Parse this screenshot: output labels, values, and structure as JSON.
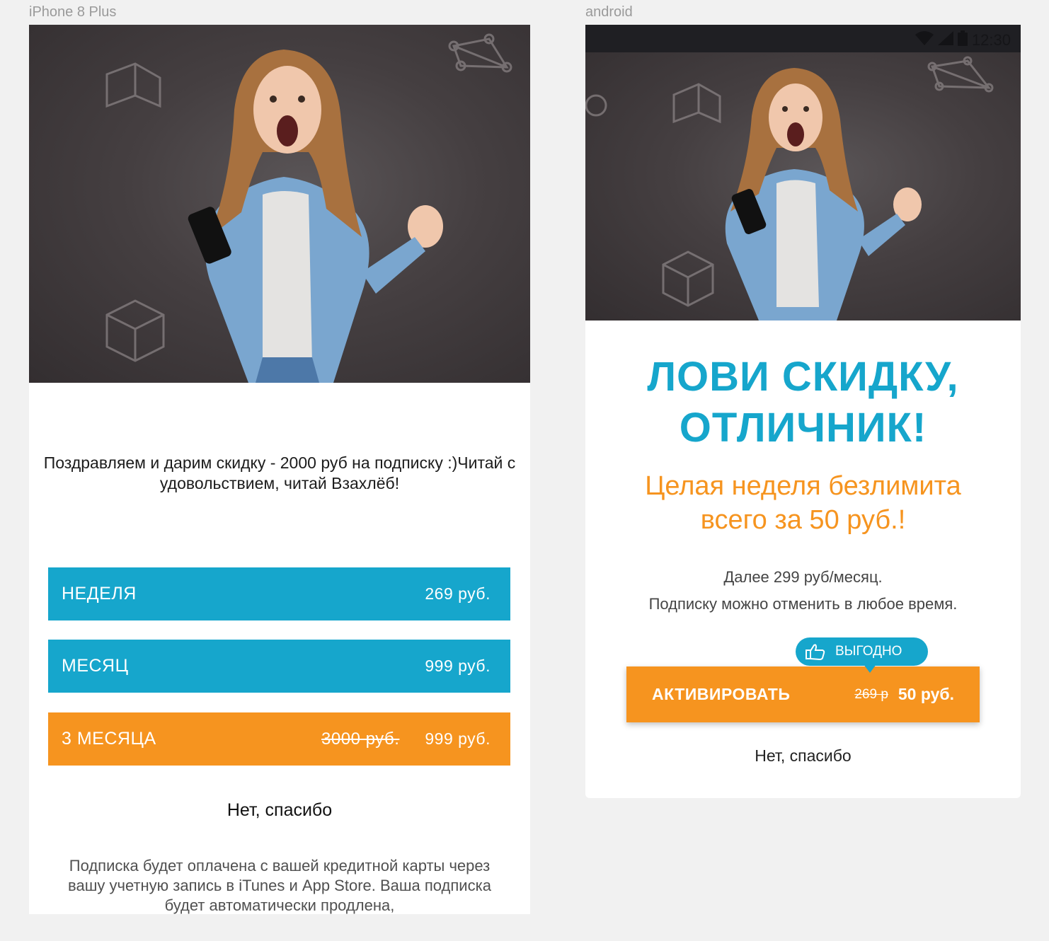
{
  "frames": {
    "ios_label": "iPhone 8 Plus",
    "android_label": "android"
  },
  "ios": {
    "congrats_text": "Поздравляем и дарим скидку - 2000 руб на подписку :)Читай с удовольствием, читай Взахлёб!",
    "plans": [
      {
        "name": "НЕДЕЛЯ",
        "old_price": "",
        "price": "269 руб."
      },
      {
        "name": "МЕСЯЦ",
        "old_price": "",
        "price": "999 руб."
      },
      {
        "name": "3 МЕСЯЦА",
        "old_price": "3000 руб.",
        "price": "999 руб."
      }
    ],
    "decline": "Нет, спасибо",
    "legal": "Подписка будет оплачена с вашей кредитной карты через вашу учетную запись в iTunes и App Store. Ваша подписка будет автоматически продлена,"
  },
  "android": {
    "status_time": "12:30",
    "title_line1": "ЛОВИ СКИДКУ,",
    "title_line2": "ОТЛИЧНИК!",
    "subtitle_line1": "Целая неделя безлимита",
    "subtitle_line2": "всего за 50 руб.!",
    "note_line1": "Далее 299 руб/месяц.",
    "note_line2": "Подписку можно отменить в любое время.",
    "badge": "ВЫГОДНО",
    "activate_label": "АКТИВИРОВАТЬ",
    "old_price": "269 р",
    "new_price": "50 руб.",
    "decline": "Нет, спасибо"
  },
  "colors": {
    "blue": "#16a6cc",
    "orange": "#f6941f",
    "background": "#f1f1f1"
  },
  "icons": [
    "wifi-icon",
    "signal-icon",
    "battery-icon",
    "thumbs-up-icon"
  ]
}
